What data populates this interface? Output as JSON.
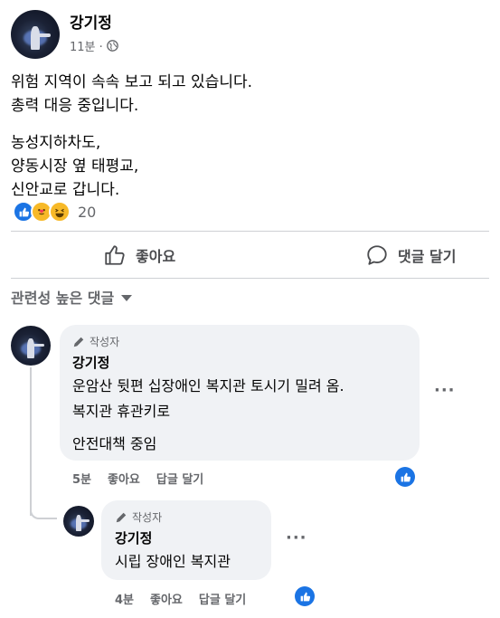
{
  "post": {
    "author": "강기정",
    "time": "11분 · ",
    "privacy_icon": "globe-icon",
    "lines_p1": [
      "위험 지역이 속속 보고 되고 있습니다.",
      "총력 대응 중입니다."
    ],
    "lines_p2": [
      "농성지하차도,",
      "양동시장 옆 태평교,",
      "신안교로 갑니다."
    ],
    "reaction_icons": [
      "like-icon",
      "care-icon",
      "haha-icon"
    ],
    "reaction_count": "20"
  },
  "actions": {
    "like": "좋아요",
    "comment": "댓글 달기"
  },
  "comments_sort": "관련성 높은 댓글",
  "comments": [
    {
      "badge": "작성자",
      "author": "강기정",
      "lines": [
        "운암산 뒷편 십장애인 복지관 토시기 밀려 옴.",
        "복지관 휴관키로",
        "안전대책 중임"
      ],
      "time": "5분",
      "like": "좋아요",
      "reply": "답글 달기",
      "more": "···"
    },
    {
      "badge": "작성자",
      "author": "강기정",
      "lines": [
        "시립 장애인 복지관"
      ],
      "time": "4분",
      "like": "좋아요",
      "reply": "답글 달기",
      "more": "···"
    }
  ],
  "colors": {
    "accent": "#1b74e4",
    "secondary_text": "#65676b",
    "bubble": "#f0f2f5"
  }
}
